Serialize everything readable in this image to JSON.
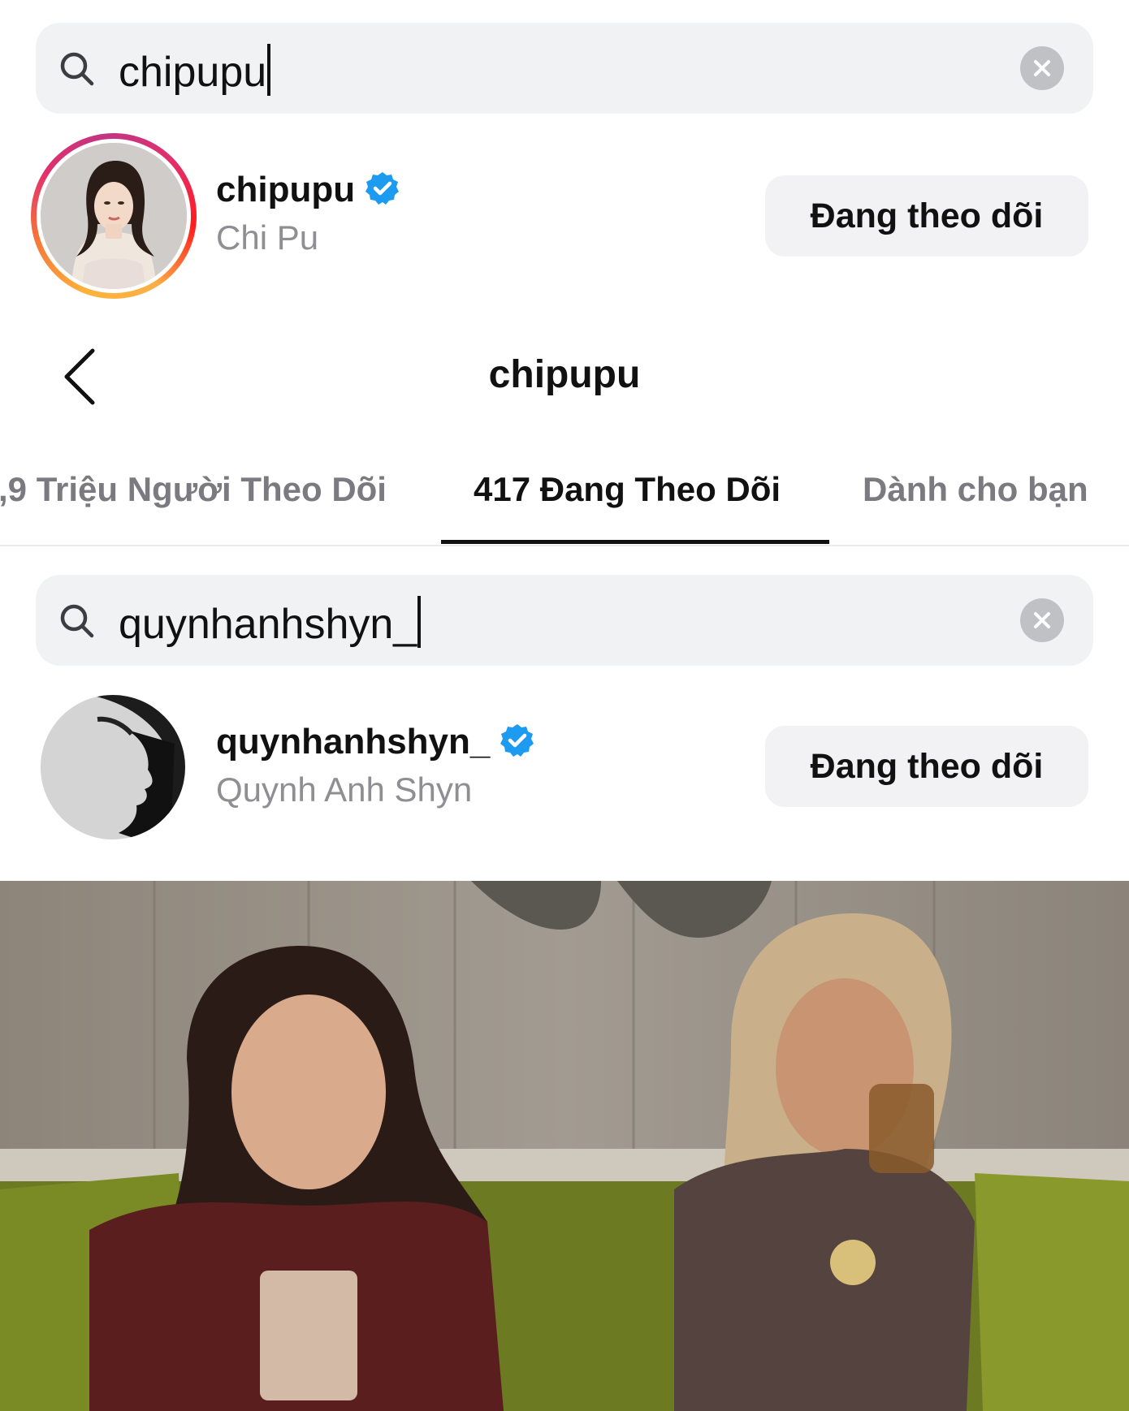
{
  "search_top": {
    "query": "chipupu",
    "icon": "search-icon",
    "clear_icon": "clear-icon"
  },
  "result_top": {
    "username": "chipupu",
    "full_name": "Chi Pu",
    "verified_icon": "verified-badge-icon",
    "follow_label": "Đang theo dõi"
  },
  "header": {
    "title": "chipupu",
    "back_icon": "chevron-left-icon"
  },
  "tabs": [
    {
      "label": ",9 Triệu Người Theo Dõi",
      "active": false
    },
    {
      "label": "417 Đang Theo Dõi",
      "active": true
    },
    {
      "label": "Dành cho bạn",
      "active": false
    }
  ],
  "search_following": {
    "query": "quynhanhshyn_",
    "icon": "search-icon",
    "clear_icon": "clear-icon"
  },
  "result_following": {
    "username": "quynhanhshyn_",
    "full_name": "Quynh Anh Shyn",
    "verified_icon": "verified-badge-icon",
    "follow_label": "Đang theo dõi"
  },
  "colors": {
    "verified": "#1d9bf0",
    "muted_text": "#8e8e93",
    "search_bg": "#f1f2f4"
  }
}
